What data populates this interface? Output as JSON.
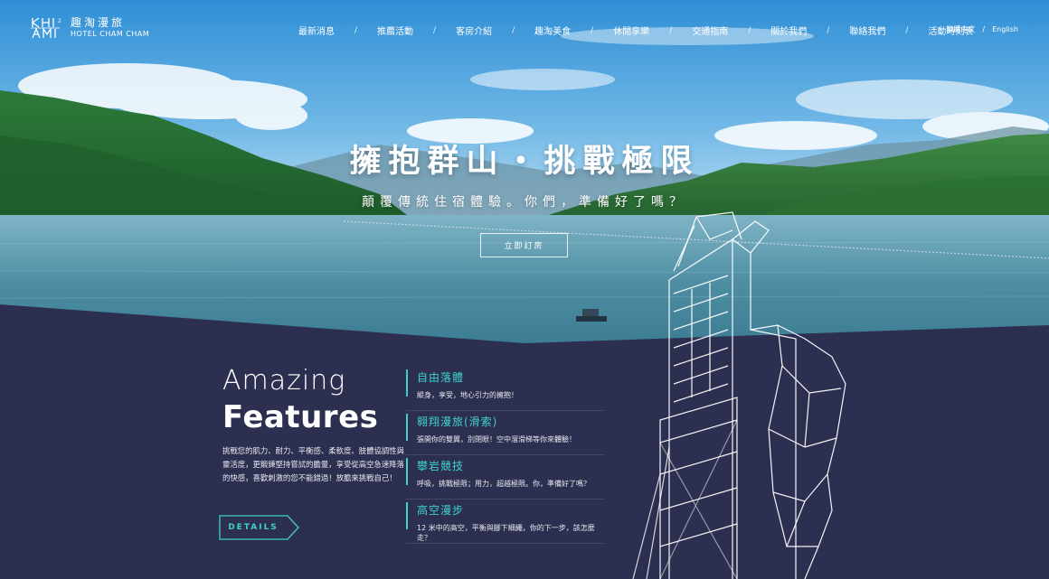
{
  "brand": {
    "logo_mark": "KHI² / AMI",
    "name_cn": "趣淘漫旅",
    "name_en": "HOTEL CHAM CHAM"
  },
  "nav": {
    "items": [
      "最新消息",
      "推薦活動",
      "客房介紹",
      "趣淘美食",
      "休閒享樂",
      "交通指南",
      "關於我們",
      "聯絡我們",
      "活動時刻表"
    ],
    "separator": "/"
  },
  "lang": {
    "zh": "繁體中文",
    "separator": "/",
    "en": "English"
  },
  "hero": {
    "title": "擁抱群山・挑戰極限",
    "subtitle": "顛覆傳統住宿體驗。你們，準備好了嗎？",
    "book_label": "立即訂房"
  },
  "features": {
    "title_line1": "Amazing",
    "title_line2": "Features",
    "description": "挑戰您的肌力、耐力、平衡感、柔軟度、肢體協調性與靈活度，更鍛鍊堅持嘗試的膽量，享受從高空急速降落的快感，喜歡刺激的您不能錯過！放膽來挑戰自己！",
    "details_label": "DETAILS",
    "items": [
      {
        "title": "自由落體",
        "desc": "縱身，享受，地心引力的擁抱！"
      },
      {
        "title": "翱翔漫旅(滑索)",
        "desc": "張開你的雙翼，別閉眼！空中溜滑梯等你來體驗！"
      },
      {
        "title": "攀岩競技",
        "desc": "呼吸，挑戰極限；用力，超越極限。你，準備好了嗎？"
      },
      {
        "title": "高空漫步",
        "desc": "12 米中的高空，平衡與腳下細繩，你的下一步，該怎麼走？"
      }
    ]
  },
  "colors": {
    "accent": "#3ed2c9",
    "navy": "#2c2f4f"
  }
}
